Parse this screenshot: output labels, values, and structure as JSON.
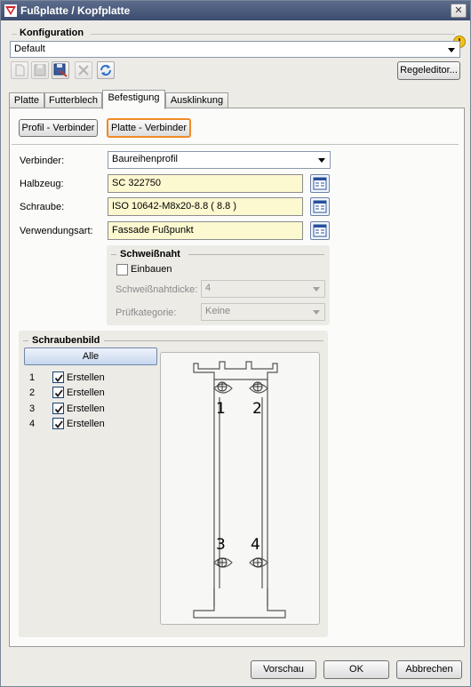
{
  "window": {
    "title": "Fußplatte / Kopfplatte",
    "close_glyph": "✕"
  },
  "config": {
    "heading": "Konfiguration",
    "value": "Default",
    "rule_editor_label": "Regeleditor...",
    "info_icon": "info-icon"
  },
  "toolbar": {
    "icons": [
      "new-icon",
      "save-icon",
      "save-as-icon",
      "delete-icon",
      "refresh-icon"
    ]
  },
  "tabs": [
    "Platte",
    "Futterblech",
    "Befestigung",
    "Ausklinkung"
  ],
  "active_tab": "Befestigung",
  "connector_buttons": {
    "profile": "Profil - Verbinder",
    "plate": "Platte - Verbinder"
  },
  "form": {
    "verbinder": {
      "label": "Verbinder:",
      "value": "Baureihenprofil"
    },
    "halbzeug": {
      "label": "Halbzeug:",
      "value": "SC  322750"
    },
    "schraube": {
      "label": "Schraube:",
      "value": "ISO 10642-M8x20-8.8  ( 8.8 )"
    },
    "verwendungsart": {
      "label": "Verwendungsart:",
      "value": "Fassade Fußpunkt"
    }
  },
  "weld": {
    "heading": "Schweißnaht",
    "install_label": "Einbauen",
    "install_checked": false,
    "thickness_label": "Schweißnahtdicke:",
    "thickness_value": "4",
    "category_label": "Prüfkategorie:",
    "category_value": "Keine"
  },
  "screw_pattern": {
    "heading": "Schraubenbild",
    "all_button": "Alle",
    "rows": [
      {
        "num": "1",
        "label": "Erstellen",
        "checked": true
      },
      {
        "num": "2",
        "label": "Erstellen",
        "checked": true
      },
      {
        "num": "3",
        "label": "Erstellen",
        "checked": true
      },
      {
        "num": "4",
        "label": "Erstellen",
        "checked": true
      }
    ],
    "drawing_labels": [
      "1",
      "2",
      "3",
      "4"
    ]
  },
  "footer": {
    "preview": "Vorschau",
    "ok": "OK",
    "cancel": "Abbrechen"
  },
  "colors": {
    "field_bg": "#fcf8d0",
    "active_button_border": "#f08a24",
    "titlebar": "#4a5b7d"
  }
}
